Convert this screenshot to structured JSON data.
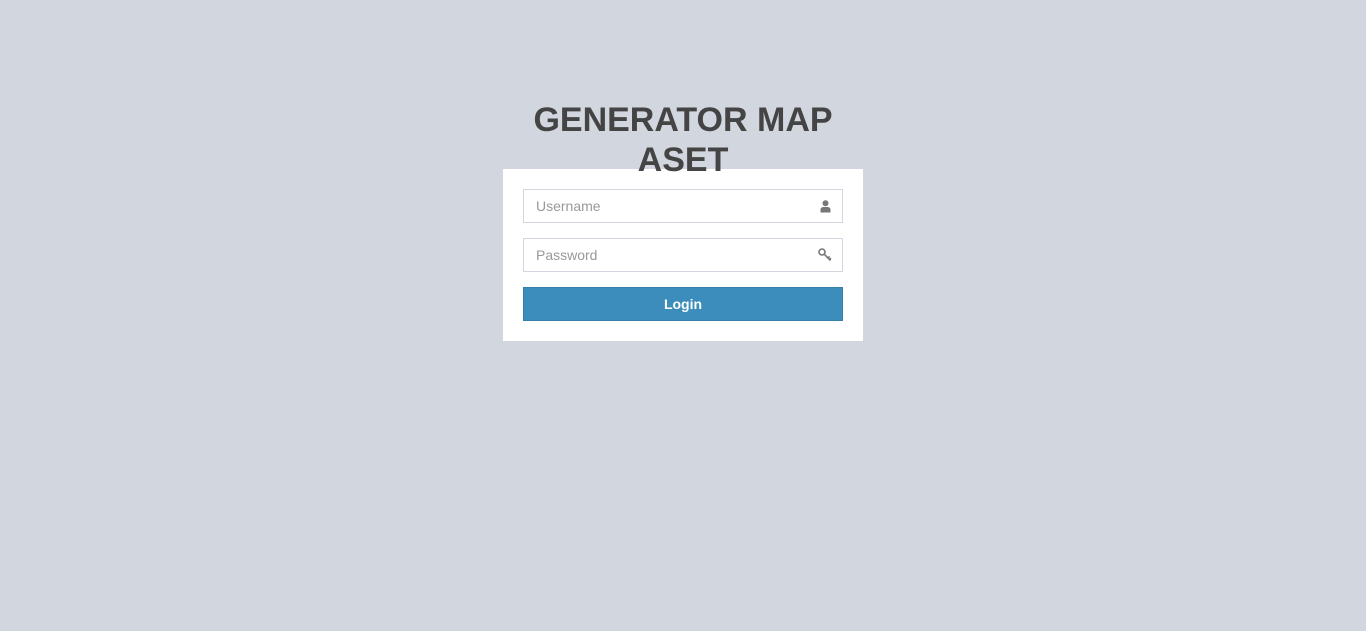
{
  "header": {
    "title": "GENERATOR MAP ASET"
  },
  "login_form": {
    "username_placeholder": "Username",
    "username_value": "",
    "username_icon": "user-icon",
    "password_placeholder": "Password",
    "password_value": "",
    "password_icon": "key-icon",
    "login_label": "Login"
  },
  "colors": {
    "background": "#d2d6de",
    "accent": "#3c8dbc",
    "title": "#444444"
  }
}
